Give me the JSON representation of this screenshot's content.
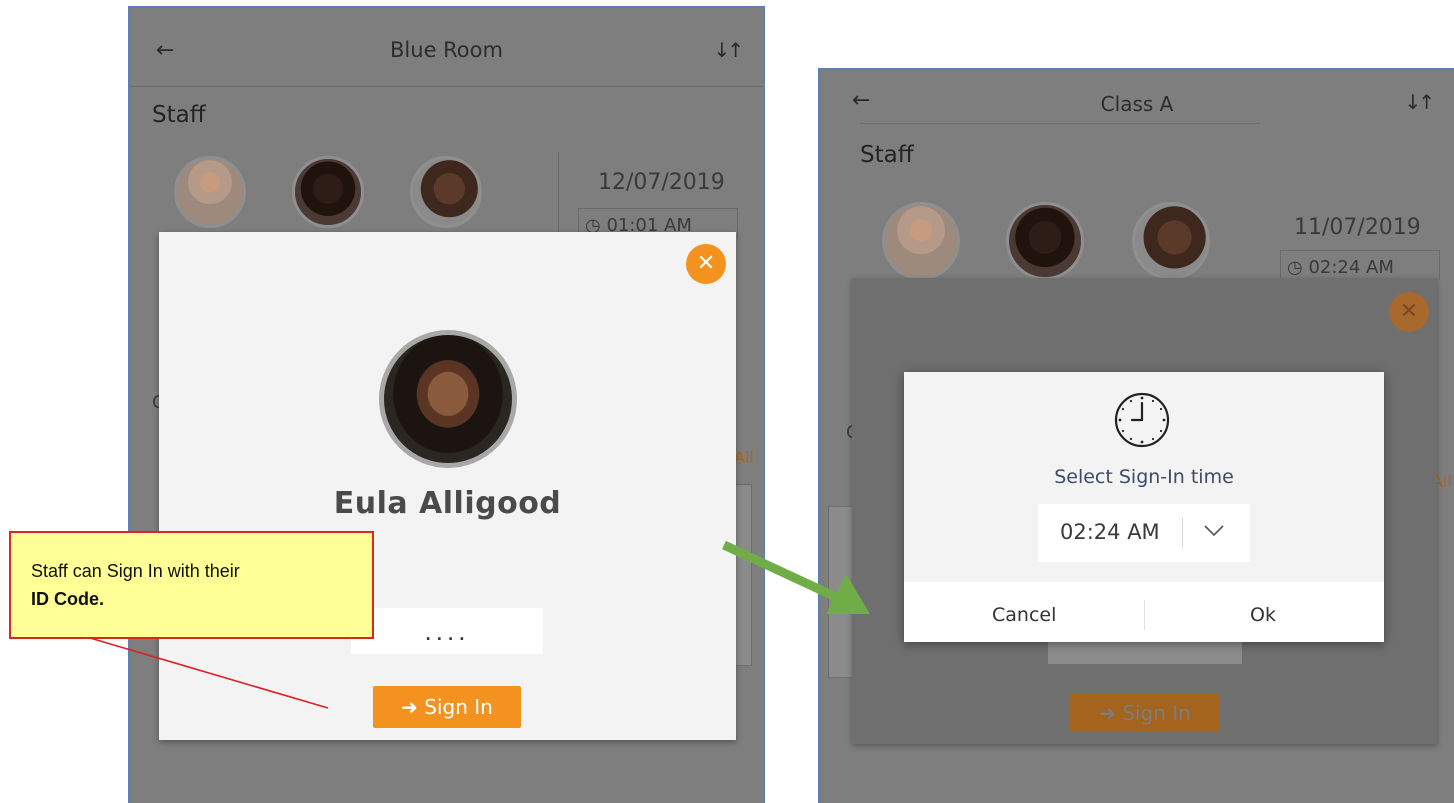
{
  "panel_left": {
    "title": "Blue Room",
    "staff_label": "Staff",
    "date": "12/07/2019",
    "time_partial": "01:01 AM",
    "side_letter": "C",
    "side_orange": "All",
    "modal": {
      "staff_name": "Eula Alligood",
      "pin_value": "....",
      "sign_in_label": "Sign In"
    }
  },
  "panel_right": {
    "title": "Class A",
    "staff_label": "Staff",
    "date": "11/07/2019",
    "time_partial": "02:24 AM",
    "side_letter": "C",
    "side_orange": "All",
    "pin_peek": "....",
    "sign_in_label": "Sign In",
    "picker": {
      "title": "Select Sign-In time",
      "time_value": "02:24 AM",
      "cancel_label": "Cancel",
      "ok_label": "Ok"
    }
  },
  "callout": {
    "text_line1": "Staff can Sign In with their",
    "text_bold": "ID Code."
  },
  "colors": {
    "accent_orange": "#f3921f",
    "callout_bg": "#ffff96",
    "callout_border": "#d92626",
    "arrow_green": "#70ad47",
    "panel_border": "#5b7fb8"
  },
  "icons": [
    "back-arrow-icon",
    "sort-icon",
    "close-icon",
    "sign-in-icon",
    "clock-icon",
    "chevron-down-icon"
  ]
}
